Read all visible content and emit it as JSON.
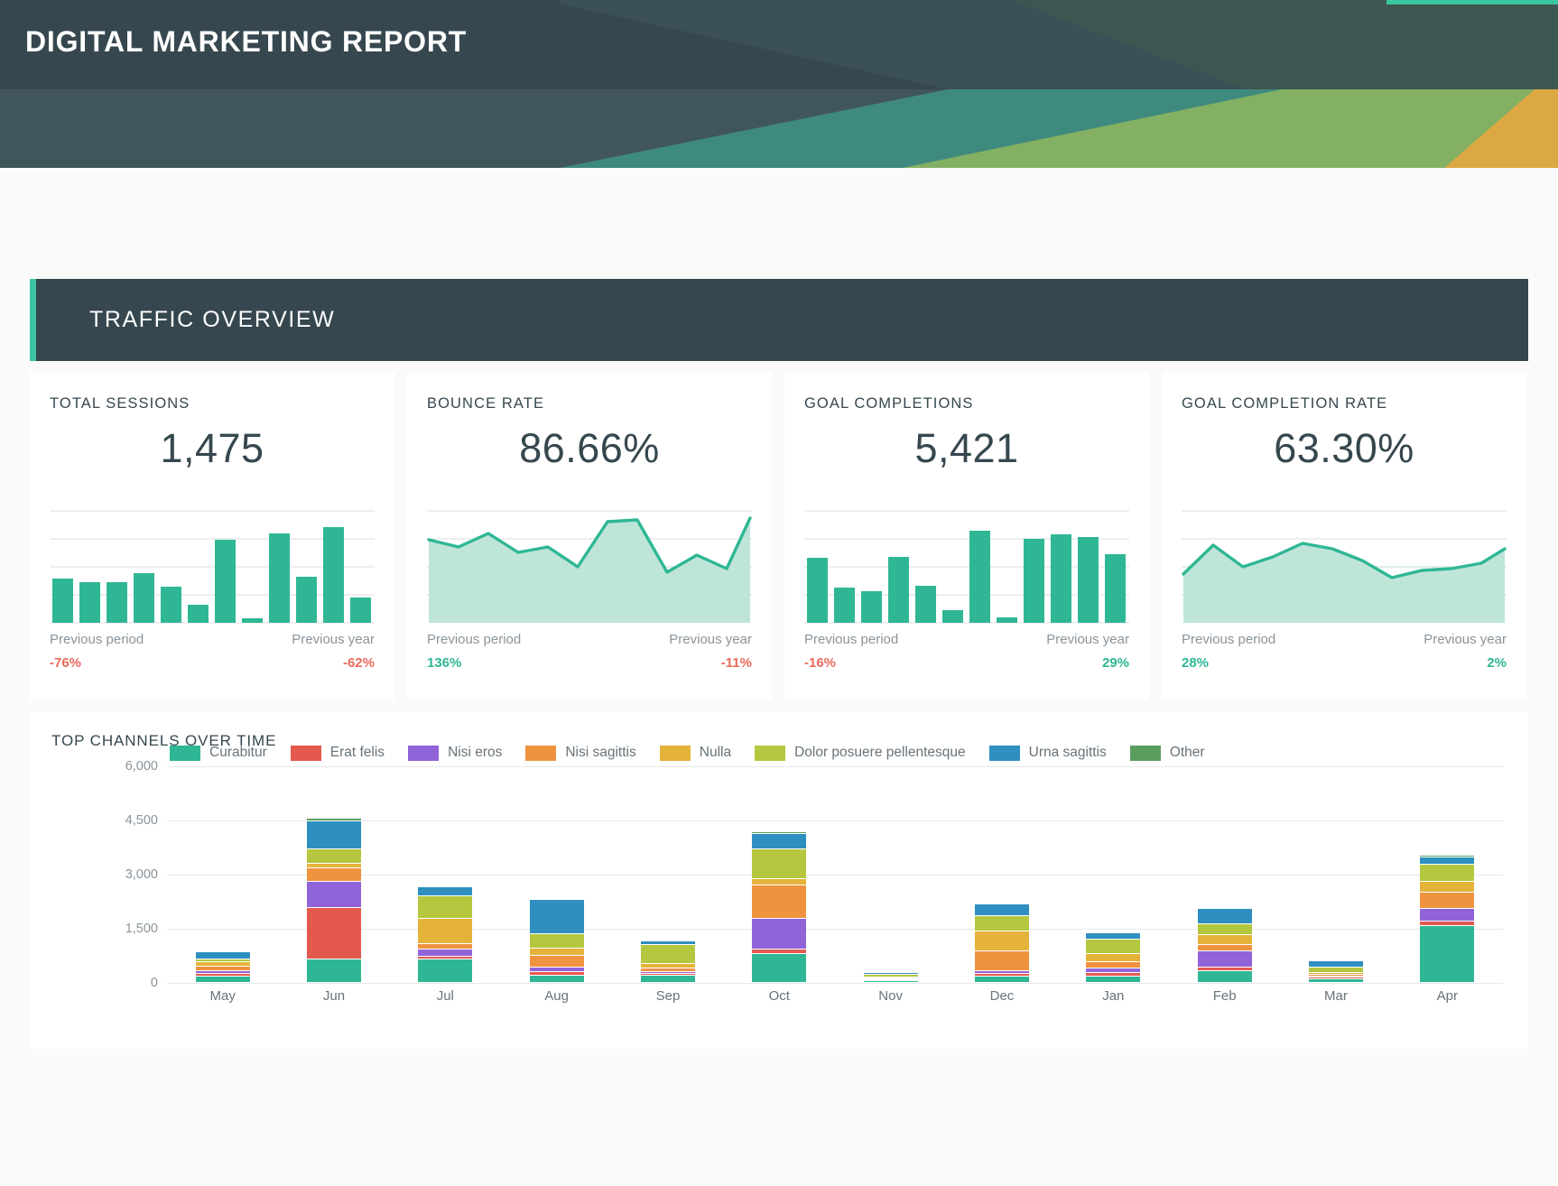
{
  "header": {
    "title": "DIGITAL MARKETING REPORT",
    "bg_color": "#36474f",
    "accent_color": "#3ac6a0"
  },
  "section": {
    "title": "TRAFFIC OVERVIEW",
    "accent_color": "#3ac6a0",
    "bg_color": "#36474f"
  },
  "kpis": [
    {
      "label": "TOTAL SESSIONS",
      "value": "1,475",
      "chart_type": "bar",
      "prev_period_label": "Previous period",
      "prev_period_delta": "-76%",
      "prev_period_dir": "neg",
      "prev_year_label": "Previous year",
      "prev_year_delta": "-62%",
      "prev_year_dir": "neg"
    },
    {
      "label": "BOUNCE RATE",
      "value": "86.66%",
      "chart_type": "area",
      "prev_period_label": "Previous period",
      "prev_period_delta": "136%",
      "prev_period_dir": "pos",
      "prev_year_label": "Previous year",
      "prev_year_delta": "-11%",
      "prev_year_dir": "neg"
    },
    {
      "label": "GOAL COMPLETIONS",
      "value": "5,421",
      "chart_type": "bar",
      "prev_period_label": "Previous period",
      "prev_period_delta": "-16%",
      "prev_period_dir": "neg",
      "prev_year_label": "Previous year",
      "prev_year_delta": "29%",
      "prev_year_dir": "pos"
    },
    {
      "label": "GOAL COMPLETION RATE",
      "value": "63.30%",
      "chart_type": "area",
      "prev_period_label": "Previous period",
      "prev_period_delta": "28%",
      "prev_period_dir": "pos",
      "prev_year_label": "Previous year",
      "prev_year_delta": "2%",
      "prev_year_dir": "pos"
    }
  ],
  "bottom_chart": {
    "title": "TOP CHANNELS OVER TIME"
  },
  "chart_data": [
    {
      "type": "bar",
      "name": "total-sessions-sparkline",
      "title": "TOTAL SESSIONS",
      "values": [
        42,
        39,
        39,
        48,
        35,
        17,
        80,
        4,
        86,
        44,
        92,
        24
      ],
      "ylim": [
        0,
        110
      ],
      "color": "#2fb795",
      "grid": true
    },
    {
      "type": "area",
      "name": "bounce-rate-sparkline",
      "title": "BOUNCE RATE",
      "values": [
        72,
        66,
        78,
        63,
        66,
        50,
        85,
        86,
        44,
        62,
        48,
        88
      ],
      "ylim": [
        0,
        100
      ],
      "color": "#2fb795",
      "fill": "#bfe5d9",
      "grid": true
    },
    {
      "type": "bar",
      "name": "goal-completions-sparkline",
      "title": "GOAL COMPLETIONS",
      "values": [
        62,
        34,
        30,
        63,
        36,
        12,
        85,
        5,
        79,
        82,
        79,
        65
      ],
      "ylim": [
        0,
        110
      ],
      "color": "#2fb795",
      "grid": true
    },
    {
      "type": "area",
      "name": "goal-completion-rate-sparkline",
      "title": "GOAL COMPLETION RATE",
      "values": [
        44,
        76,
        50,
        62,
        74,
        70,
        56,
        38,
        47,
        49,
        55,
        72
      ],
      "ylim": [
        0,
        100
      ],
      "color": "#2fb795",
      "fill": "#bfe5d9",
      "grid": true
    },
    {
      "type": "bar",
      "name": "top-channels-over-time",
      "stacked": true,
      "title": "TOP CHANNELS OVER TIME",
      "xlabel": "",
      "ylabel": "",
      "ylim": [
        0,
        6000
      ],
      "yticks": [
        0,
        1500,
        3000,
        4500,
        6000
      ],
      "ytick_labels": [
        "0",
        "1,500",
        "3,000",
        "4,500",
        "6,000"
      ],
      "grid": true,
      "legend_position": "top",
      "categories": [
        "May",
        "Jun",
        "Jul",
        "Aug",
        "Sep",
        "Oct",
        "Nov",
        "Dec",
        "Jan",
        "Feb",
        "Mar",
        "Apr"
      ],
      "series": [
        {
          "name": "Curabitur",
          "color": "#2fb795",
          "values": [
            170,
            660,
            650,
            210,
            190,
            790,
            40,
            170,
            170,
            330,
            90,
            1570
          ]
        },
        {
          "name": "Erat felis",
          "color": "#e4594e",
          "values": [
            80,
            1420,
            80,
            100,
            60,
            130,
            20,
            80,
            110,
            90,
            60,
            130
          ]
        },
        {
          "name": "Nisi eros",
          "color": "#9063d8",
          "values": [
            80,
            710,
            200,
            110,
            50,
            850,
            20,
            70,
            120,
            460,
            30,
            340
          ]
        },
        {
          "name": "Nisi sagittis",
          "color": "#f0933f",
          "values": [
            130,
            390,
            140,
            330,
            110,
            930,
            20,
            560,
            180,
            180,
            40,
            450
          ]
        },
        {
          "name": "Nulla",
          "color": "#e5b33a",
          "values": [
            110,
            110,
            700,
            190,
            110,
            170,
            30,
            540,
            230,
            270,
            60,
            300
          ]
        },
        {
          "name": "Dolor posuere pellentesque",
          "color": "#b4c73e",
          "values": [
            90,
            420,
            620,
            400,
            540,
            830,
            80,
            420,
            390,
            290,
            140,
            490
          ]
        },
        {
          "name": "Urna sagittis",
          "color": "#2e8fc0",
          "values": [
            190,
            760,
            250,
            960,
            90,
            420,
            60,
            330,
            170,
            430,
            190,
            200
          ]
        },
        {
          "name": "Other",
          "color": "#5a9e5e",
          "values": [
            30,
            90,
            40,
            20,
            30,
            60,
            10,
            30,
            20,
            30,
            10,
            40
          ]
        }
      ]
    }
  ]
}
